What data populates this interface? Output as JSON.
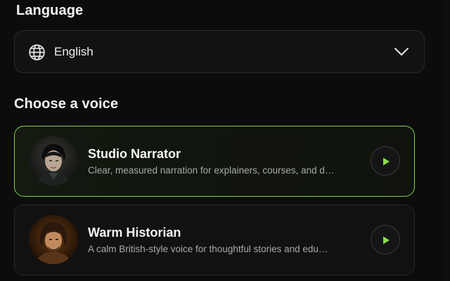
{
  "language": {
    "heading": "Language",
    "selected": "English",
    "icon": "globe-icon",
    "dropdown_icon": "chevron-down-icon"
  },
  "voices": {
    "heading": "Choose a voice",
    "items": [
      {
        "name": "Studio Narrator",
        "description": "Clear, measured narration for explainers, courses, and d…",
        "selected": true,
        "play_icon": "play-icon"
      },
      {
        "name": "Warm Historian",
        "description": "A calm British-style voice for thoughtful stories and edu…",
        "selected": false,
        "play_icon": "play-icon"
      }
    ]
  },
  "colors": {
    "background": "#0c0c0d",
    "accent": "#7fd04a",
    "play_icon": "#8fdc4e",
    "text_primary": "#f3f3f3",
    "text_secondary": "#a9a9ad"
  }
}
